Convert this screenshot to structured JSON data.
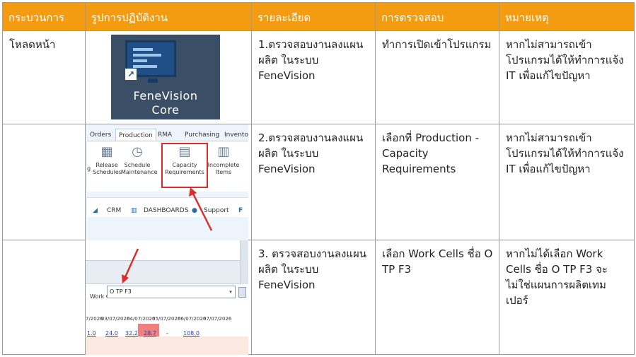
{
  "headers": [
    "กระบวนการ",
    "รูปการปฏิบัติงาน",
    "รายละเอียด",
    "การตรวจสอบ",
    "หมายเหตุ"
  ],
  "rows": [
    {
      "process": "โหลดหน้า",
      "detail": "1.ตรวจสอบงานลงแผนผลิต ในระบบ FeneVision",
      "check": "ทำการเปิดเข้าโปรแกรม",
      "note": "หากไม่สามารถเข้าโปรแกรมได้ให้ทำการแจ้ง IT  เพื่อแก้ไขปัญหา"
    },
    {
      "process": "",
      "detail": "2.ตรวจสอบงานลงแผนผลิต ในระบบ FeneVision",
      "check": "เลือกที่ Production -Capacity Requirements",
      "note": "หากไม่สามารถเข้าโปรแกรมได้ให้ทำการแจ้ง IT  เพื่อแก้ไขปัญหา"
    },
    {
      "process": "",
      "detail": "3. ตรวจสอบงานลงแผนผลิต ในระบบ FeneVision",
      "check": "เลือก Work Cells ชื่อ O TP F3",
      "note": "หากไม่ได้เลือก Work Cells ชื่อ O TP F3 จะไม่ใช่แผนการผลิตเทมเปอร์"
    }
  ],
  "image1": {
    "line1": "FeneVision",
    "line2": "Core",
    "icon": "monitor-shortcut-icon"
  },
  "image2": {
    "tabs": [
      "Orders",
      "Production",
      "RMA",
      "Purchasing",
      "Inventor"
    ],
    "buttons": [
      {
        "label1": "g",
        "label2": ""
      },
      {
        "label1": "Release",
        "label2": "Schedules"
      },
      {
        "label1": "Schedule",
        "label2": "Maintenance"
      },
      {
        "label1": "Capacity",
        "label2": "Requirements"
      },
      {
        "label1": "Incomplete",
        "label2": "Items"
      }
    ],
    "strip": [
      "CRM",
      "DASHBOARDS",
      "Support"
    ],
    "highlight_color": "#e02b2b"
  },
  "image3": {
    "label": "Work Cells",
    "value": "O TP F3",
    "dates": [
      "7/2026",
      "03/07/2026",
      "04/07/2026",
      "05/07/2026",
      "06/07/2026",
      "07/07/2026"
    ],
    "values": [
      "1.0",
      "24.0",
      "32.2",
      "28.7",
      "-",
      "108.0"
    ],
    "arrow_color": "#e02b2b"
  },
  "colors": {
    "header_bg": "#f39c12",
    "header_text": "#ffffff"
  }
}
